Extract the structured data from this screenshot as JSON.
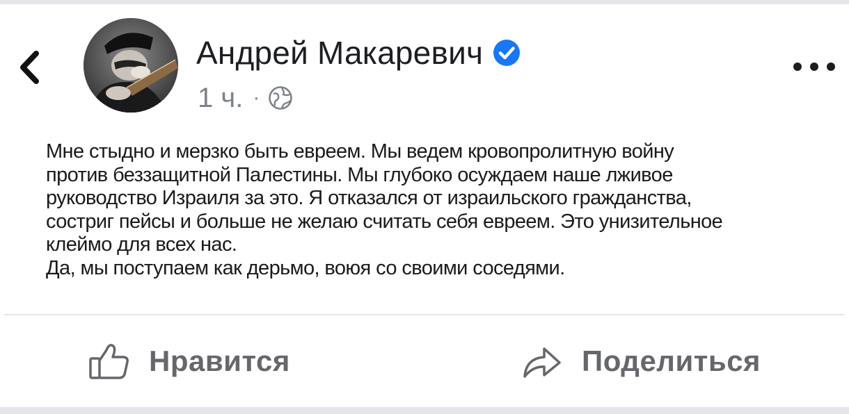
{
  "header": {
    "author_name": "Андрей Макаревич",
    "verified": true,
    "timestamp": "1 ч.",
    "separator": "·",
    "audience_icon": "globe-icon",
    "back_icon": "chevron-left-icon",
    "more_icon": "more-horizontal-icon"
  },
  "post": {
    "lines": [
      "Мне стыдно и мерзко быть евреем. Мы ведем кровопролитную войну",
      "против беззащитной Палестины. Мы глубоко осуждаем наше лживое",
      "руководство Израиля за это. Я отказался от израильского гражданства,",
      "состриг пейсы и больше не желаю считать себя евреем. Это унизительное",
      "клеймо для всех нас.",
      "Да, мы поступаем как дерьмо, воюя со своими соседями."
    ]
  },
  "actions": {
    "like_label": "Нравится",
    "share_label": "Поделиться",
    "like_icon": "thumbs-up-icon",
    "share_icon": "share-arrow-icon"
  },
  "colors": {
    "verified_badge": "#1877f2",
    "secondary_text": "#65676b"
  }
}
